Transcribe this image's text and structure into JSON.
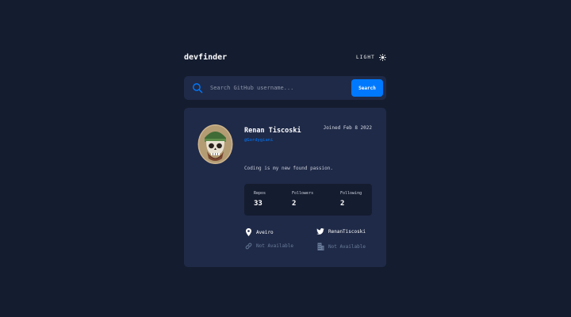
{
  "header": {
    "logo": "devfinder",
    "theme_label": "LIGHT",
    "theme_icon": "sun-icon"
  },
  "search": {
    "placeholder": "Search GitHub username...",
    "value": "",
    "button_label": "Search",
    "icon": "search-icon"
  },
  "profile": {
    "name": "Renan Tiscoski",
    "handle": "@Gordygiani",
    "joined": "Joined Feb 8 2022",
    "bio": "Coding is my new found passion.",
    "avatar_icon": "skull-avatar-icon"
  },
  "stats": [
    {
      "label": "Repos",
      "value": "33"
    },
    {
      "label": "Followers",
      "value": "2"
    },
    {
      "label": "Following",
      "value": "2"
    }
  ],
  "links": {
    "location": "Aveiro",
    "twitter": "RenanTiscoski",
    "blog": "Not Available",
    "company": "Not Available"
  },
  "colors": {
    "background": "#141c2f",
    "card": "#1f2a48",
    "accent": "#0079ff",
    "muted": "#697c9a"
  }
}
